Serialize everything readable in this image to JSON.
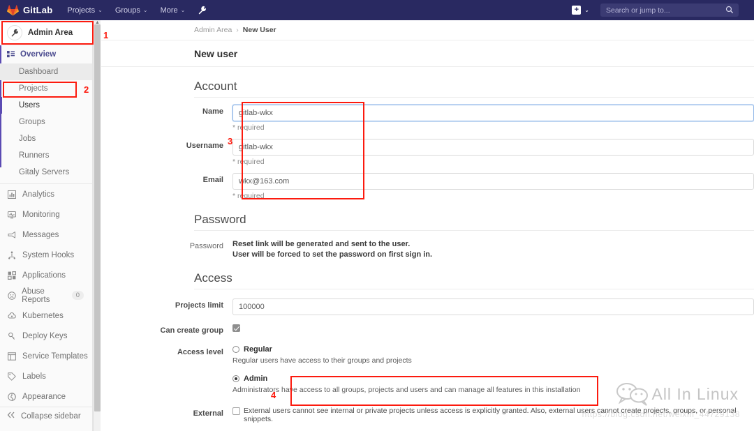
{
  "navbar": {
    "brand": "GitLab",
    "items": [
      {
        "label": "Projects",
        "caret": "⌄"
      },
      {
        "label": "Groups",
        "caret": "⌄"
      },
      {
        "label": "More",
        "caret": "⌄"
      }
    ],
    "wrench_icon": "wrench-icon",
    "plus_icon": "plus-square-icon",
    "plus_caret": "⌄",
    "search": {
      "placeholder": "Search or jump to...",
      "value": "",
      "icon": "search-icon"
    }
  },
  "sidebar": {
    "context": {
      "label": "Admin Area",
      "icon": "wrench-icon"
    },
    "section": {
      "label": "Overview",
      "icon": "overview-grid-icon"
    },
    "sub_items": [
      {
        "label": "Dashboard",
        "state": "hover"
      },
      {
        "label": "Projects",
        "state": "normal"
      },
      {
        "label": "Users",
        "state": "active"
      },
      {
        "label": "Groups",
        "state": "normal"
      },
      {
        "label": "Jobs",
        "state": "normal"
      },
      {
        "label": "Runners",
        "state": "normal"
      },
      {
        "label": "Gitaly Servers",
        "state": "normal"
      }
    ],
    "items": [
      {
        "label": "Analytics",
        "icon": "chart-icon",
        "badge": ""
      },
      {
        "label": "Monitoring",
        "icon": "monitor-icon",
        "badge": ""
      },
      {
        "label": "Messages",
        "icon": "megaphone-icon",
        "badge": ""
      },
      {
        "label": "System Hooks",
        "icon": "hook-icon",
        "badge": ""
      },
      {
        "label": "Applications",
        "icon": "applications-grid-icon",
        "badge": ""
      },
      {
        "label": "Abuse Reports",
        "icon": "abuse-face-icon",
        "badge": "0"
      },
      {
        "label": "Kubernetes",
        "icon": "kubernetes-cloud-icon",
        "badge": ""
      },
      {
        "label": "Deploy Keys",
        "icon": "key-icon",
        "badge": ""
      },
      {
        "label": "Service Templates",
        "icon": "template-icon",
        "badge": ""
      },
      {
        "label": "Labels",
        "icon": "label-tag-icon",
        "badge": ""
      },
      {
        "label": "Appearance",
        "icon": "appearance-palette-icon",
        "badge": ""
      }
    ],
    "collapse": {
      "label": "Collapse sidebar",
      "icon": "double-chevron-left-icon"
    }
  },
  "breadcrumb": {
    "root": "Admin Area",
    "separator": "›",
    "current": "New User"
  },
  "page": {
    "title": "New user"
  },
  "account": {
    "heading": "Account",
    "name": {
      "label": "Name",
      "value": "gitlab-wkx",
      "help": "* required"
    },
    "username": {
      "label": "Username",
      "value": "gitlab-wkx",
      "help": "* required"
    },
    "email": {
      "label": "Email",
      "value": "wkx@163.com",
      "help": "* required"
    }
  },
  "password": {
    "heading": "Password",
    "label": "Password",
    "line1": "Reset link will be generated and sent to the user.",
    "line2": "User will be forced to set the password on first sign in."
  },
  "access": {
    "heading": "Access",
    "projects_limit": {
      "label": "Projects limit",
      "value": "100000"
    },
    "can_create_group": {
      "label": "Can create group",
      "checked": true
    },
    "access_level": {
      "label": "Access level",
      "options": [
        {
          "label": "Regular",
          "selected": false,
          "description": "Regular users have access to their groups and projects"
        },
        {
          "label": "Admin",
          "selected": true,
          "description": "Administrators have access to all groups, projects and users and can manage all features in this installation"
        }
      ]
    },
    "external": {
      "label": "External",
      "checked": false,
      "description": "External users cannot see internal or private projects unless access is explicitly granted. Also, external users cannot create projects, groups, or personal snippets."
    }
  },
  "annotations": [
    {
      "number": "1"
    },
    {
      "number": "2"
    },
    {
      "number": "3"
    },
    {
      "number": "4"
    }
  ],
  "watermark": {
    "brand": "All In Linux",
    "url": "https://blog.csdn.net/weixin_44729138"
  },
  "colors": {
    "navbar_bg": "#292961",
    "accent_purple": "#5b4bb3",
    "annotation_red": "#fc1a0e",
    "focus_blue": "#91b7e8"
  }
}
